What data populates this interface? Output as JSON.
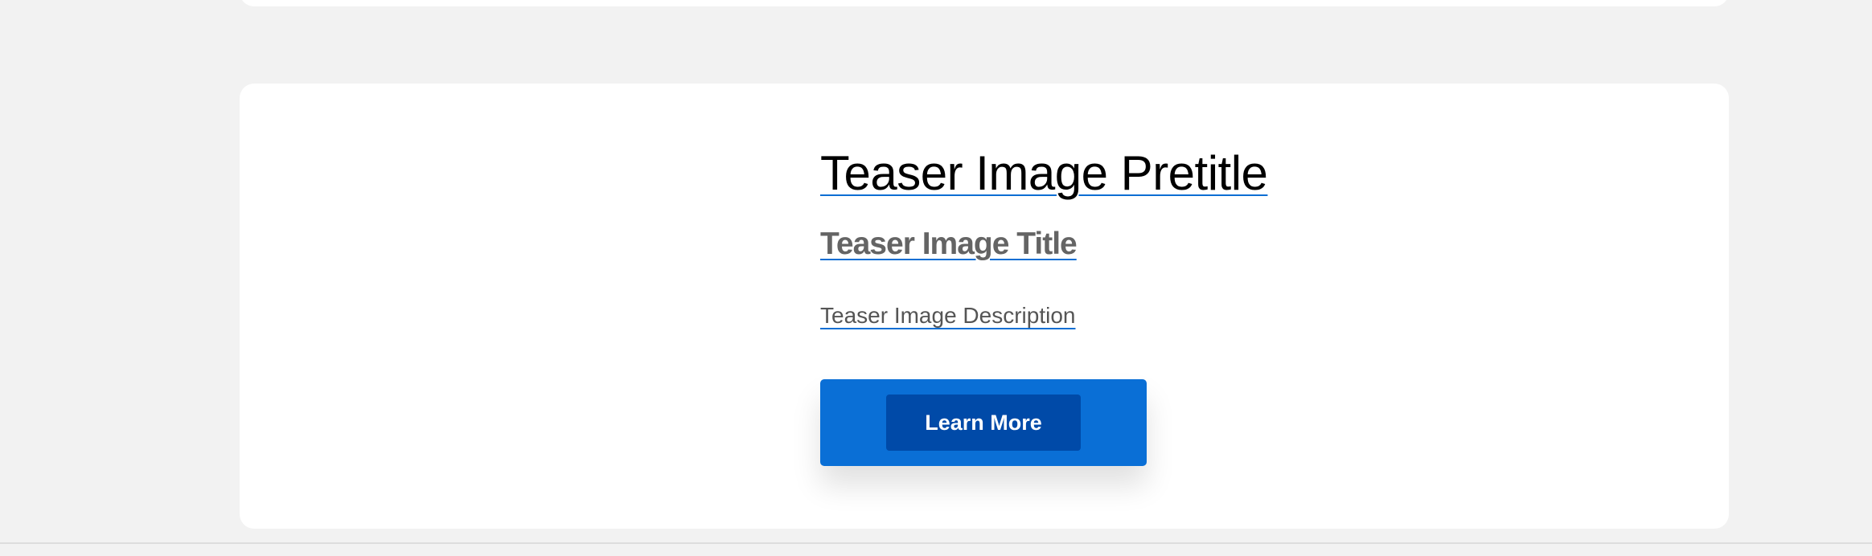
{
  "teaser": {
    "pretitle": "Teaser Image Pretitle",
    "title": "Teaser Image Title",
    "description": "Teaser Image Description",
    "cta_label": "Learn More"
  },
  "colors": {
    "page_background": "#f2f2f2",
    "card_background": "#ffffff",
    "link_underline": "#0d6ed3",
    "cta_outer": "#0a6fd6",
    "cta_inner": "#004aa8"
  }
}
